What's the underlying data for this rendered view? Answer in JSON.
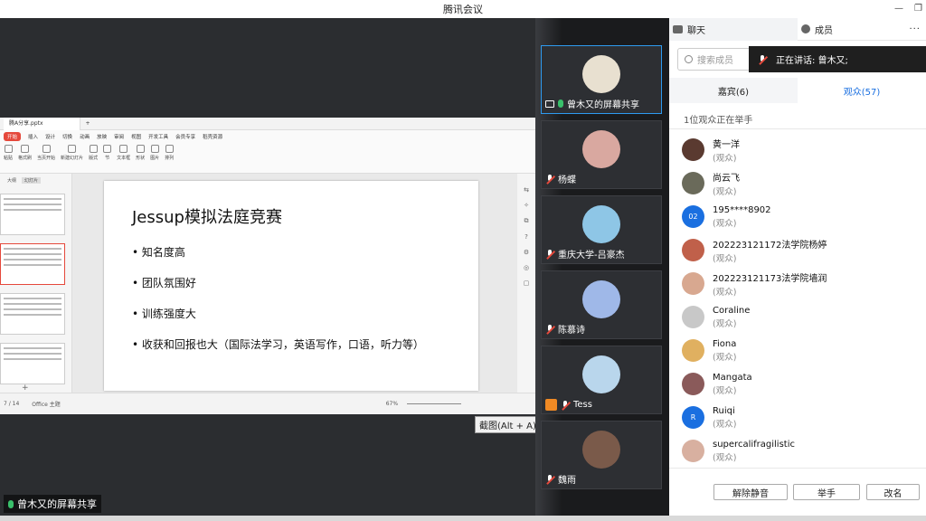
{
  "window": {
    "title": "腾讯会议"
  },
  "share": {
    "file_tab": "腾A分享.pptx",
    "menu": [
      "开始",
      "插入",
      "设计",
      "切换",
      "动画",
      "放映",
      "审阅",
      "视图",
      "开发工具",
      "会员专享",
      "稻壳资源"
    ],
    "ribbon": [
      "粘贴",
      "格式刷",
      "当页开始",
      "新建幻灯片",
      "版式",
      "节",
      "文本框",
      "形状",
      "图片",
      "排列"
    ],
    "thumb_tabs": [
      "大纲",
      "幻灯片"
    ],
    "slide": {
      "title": "Jessup模拟法庭竞赛",
      "bullets": [
        "• 知名度高",
        "• 团队氛围好",
        "• 训练强度大",
        "• 收获和回报也大（国际法学习，英语写作，口语，听力等）"
      ]
    },
    "status": {
      "page": "7 / 14",
      "theme": "Office 主题",
      "zoom": "67%"
    },
    "tooltip": "截图(Alt + A)",
    "sharer_label": "曾木又的屏幕共享"
  },
  "video_tiles": [
    {
      "name": "曾木又的屏幕共享",
      "color": "#e8e0d0",
      "active": true,
      "mic": "on",
      "icon": "screen"
    },
    {
      "name": "杨蝶",
      "color": "#d9a8a0",
      "mic": "muted"
    },
    {
      "name": "重庆大学-吕豪杰",
      "color": "#8ec6e6",
      "mic": "muted"
    },
    {
      "name": "陈慕诗",
      "color": "#9fb8e8",
      "mic": "muted"
    },
    {
      "name": "Tess",
      "color": "#b9d6ec",
      "mic": "muted",
      "icon": "person"
    },
    {
      "name": "魏雨",
      "color": "#7a5a4a",
      "mic": "muted"
    }
  ],
  "panel": {
    "tab_chat": "聊天",
    "tab_members": "成员",
    "more": "···",
    "search_placeholder": "搜索成员",
    "speaking": "正在讲话: 曾木又;",
    "tab_guests": "嘉宾(6)",
    "tab_audience": "观众(57)",
    "hand_raised": "1位观众正在举手",
    "members": [
      {
        "name": "黄一洋",
        "role": "(观众)",
        "color": "#5a3a30"
      },
      {
        "name": "尚云飞",
        "role": "(观众)",
        "color": "#6a6a5a"
      },
      {
        "name": "195****8902",
        "role": "(观众)",
        "color": "#1a6fe0",
        "initials": "02"
      },
      {
        "name": "202223121172法学院杨婷",
        "role": "(观众)",
        "color": "#c0604a"
      },
      {
        "name": "202223121173法学院墙润",
        "role": "(观众)",
        "color": "#d8a890"
      },
      {
        "name": "Coraline",
        "role": "(观众)",
        "color": "#c8c8c8"
      },
      {
        "name": "Fiona",
        "role": "(观众)",
        "color": "#e0b060"
      },
      {
        "name": "Mangata",
        "role": "(观众)",
        "color": "#8a5a5a"
      },
      {
        "name": "Ruiqi",
        "role": "(观众)",
        "color": "#1a6fe0",
        "initials": "R"
      },
      {
        "name": "supercalifragilistic",
        "role": "(观众)",
        "color": "#d8b0a0"
      }
    ],
    "btn_unmute": "解除静音",
    "btn_raise": "举手",
    "btn_rename": "改名"
  }
}
